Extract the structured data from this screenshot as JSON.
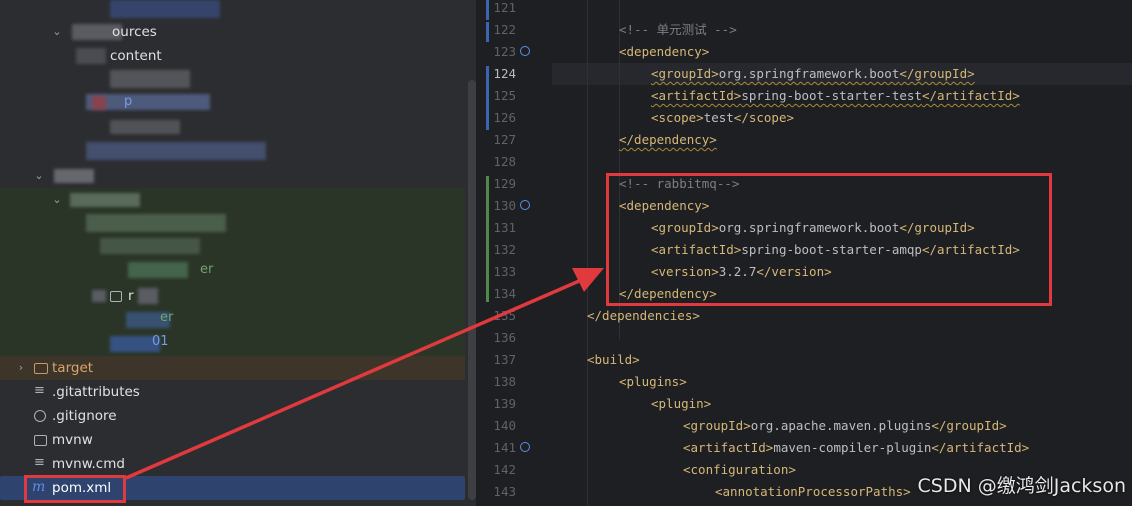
{
  "tree": {
    "rows": {
      "sources_label": "ources",
      "content_label": "content",
      "target_label": "target",
      "gitattributes_label": ".gitattributes",
      "gitignore_label": ".gitignore",
      "mvnw_label": "mvnw",
      "mvnw_cmd_label": "mvnw.cmd",
      "pom_label": "pom.xml",
      "frag_er1": "er",
      "frag_p": "p",
      "frag_r": "r",
      "frag_er2": "er",
      "frag_01": "01"
    }
  },
  "editor": {
    "lines": [
      {
        "num": "121",
        "code": ""
      },
      {
        "num": "122",
        "code": "<!-- 单元测试 -->"
      },
      {
        "num": "123",
        "code": "<dependency>"
      },
      {
        "num": "124",
        "code": "<groupId>org.springframework.boot</groupId>"
      },
      {
        "num": "125",
        "code": "<artifactId>spring-boot-starter-test</artifactId>"
      },
      {
        "num": "126",
        "code": "<scope>test</scope>"
      },
      {
        "num": "127",
        "code": "</dependency>"
      },
      {
        "num": "128",
        "code": ""
      },
      {
        "num": "129",
        "code": "<!-- rabbitmq-->"
      },
      {
        "num": "130",
        "code": "<dependency>"
      },
      {
        "num": "131",
        "code": "<groupId>org.springframework.boot</groupId>"
      },
      {
        "num": "132",
        "code": "<artifactId>spring-boot-starter-amqp</artifactId>"
      },
      {
        "num": "133",
        "code": "<version>3.2.7</version>"
      },
      {
        "num": "134",
        "code": "</dependency>"
      },
      {
        "num": "135",
        "code": "</dependencies>"
      },
      {
        "num": "136",
        "code": ""
      },
      {
        "num": "137",
        "code": "<build>"
      },
      {
        "num": "138",
        "code": "<plugins>"
      },
      {
        "num": "139",
        "code": "<plugin>"
      },
      {
        "num": "140",
        "code": "<groupId>org.apache.maven.plugins</groupId>"
      },
      {
        "num": "141",
        "code": "<artifactId>maven-compiler-plugin</artifactId>"
      },
      {
        "num": "142",
        "code": "<configuration>"
      },
      {
        "num": "143",
        "code": "<annotationProcessorPaths>"
      }
    ]
  },
  "watermark": "CSDN @缴鸿剑Jackson",
  "colors": {
    "annotation_red": "#e0393e",
    "tag": "#d5b778",
    "comment": "#7a7e85",
    "text": "#bcbec4",
    "vcs_modified": "#3a65b0",
    "vcs_added": "#4f8a4a"
  }
}
